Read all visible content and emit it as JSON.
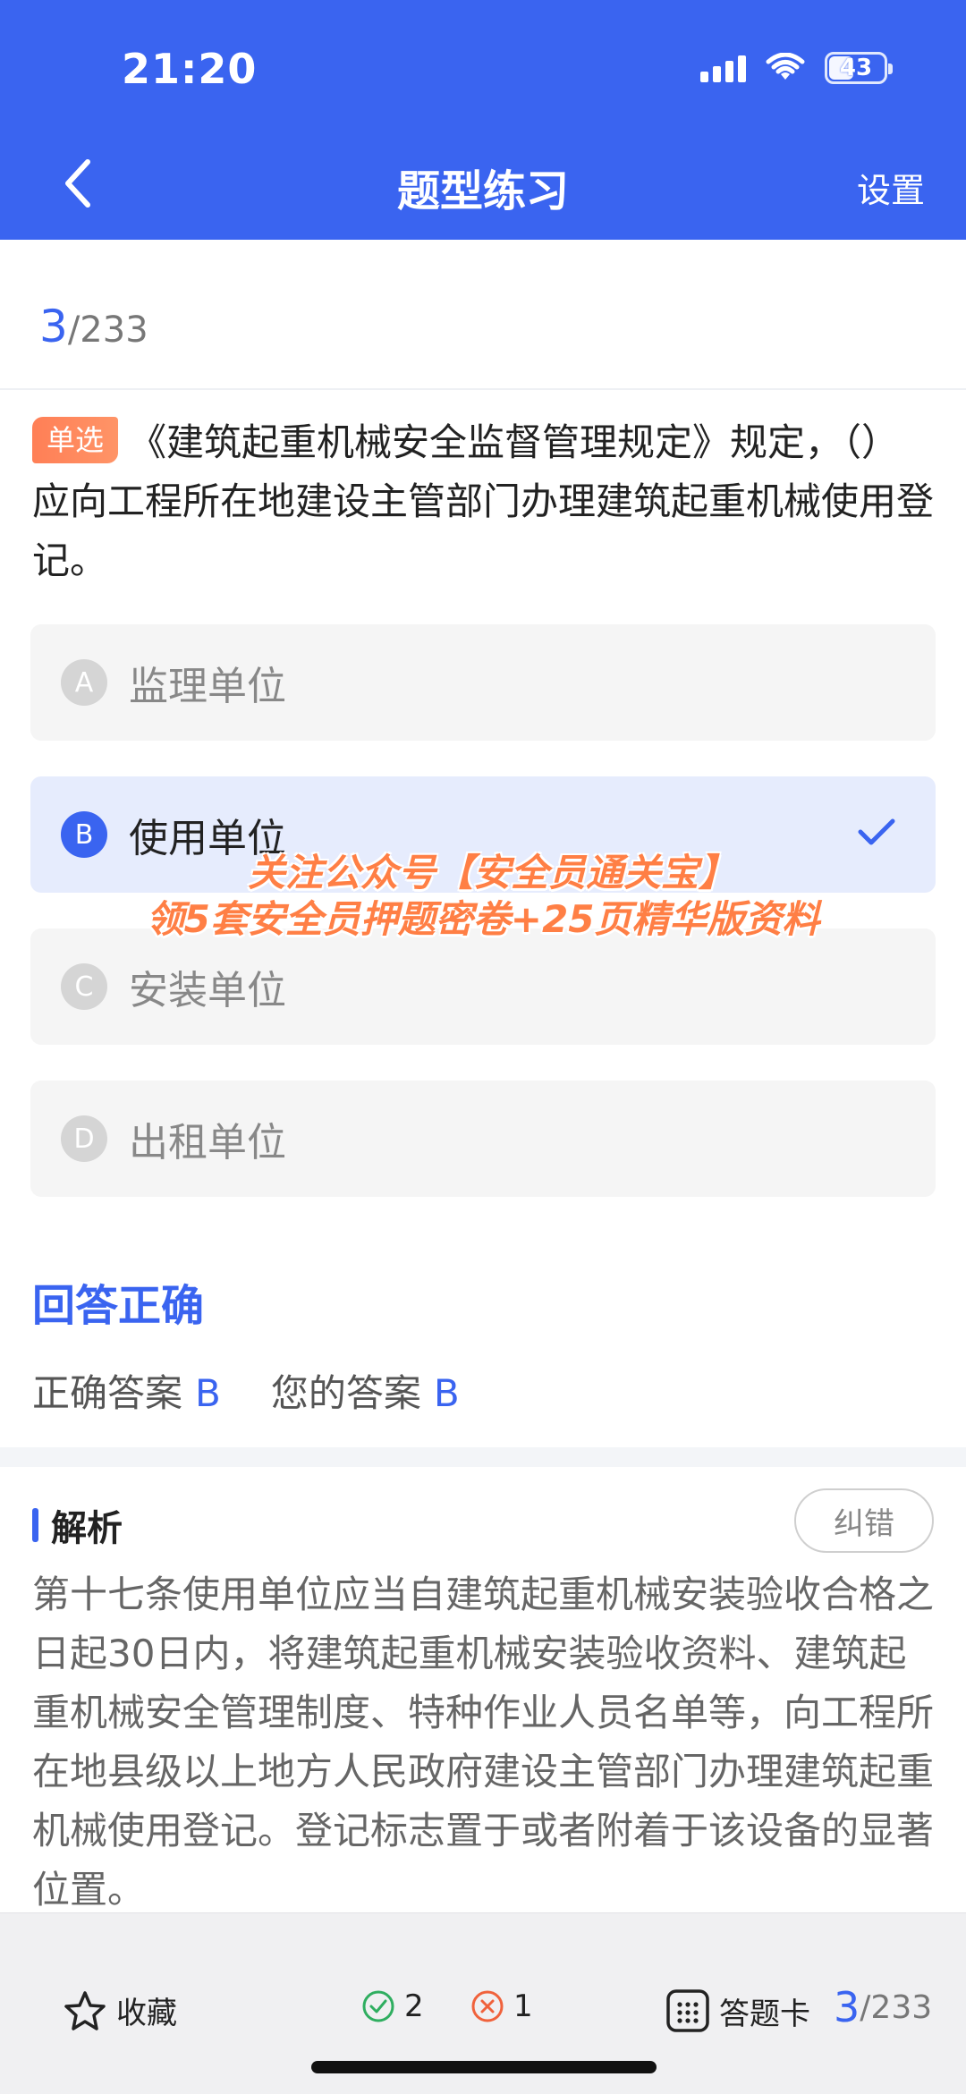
{
  "status_bar": {
    "time": "21:20",
    "battery": "43"
  },
  "header": {
    "title": "题型练习",
    "settings_label": "设置"
  },
  "progress": {
    "current": "3",
    "total": "/233"
  },
  "question": {
    "type_tag": "单选",
    "text": "《建筑起重机械安全监督管理规定》规定，（）应向工程所在地建设主管部门办理建筑起重机械使用登记。"
  },
  "options": [
    {
      "letter": "A",
      "text": "监理单位",
      "selected": false
    },
    {
      "letter": "B",
      "text": "使用单位",
      "selected": true
    },
    {
      "letter": "C",
      "text": "安装单位",
      "selected": false
    },
    {
      "letter": "D",
      "text": "出租单位",
      "selected": false
    }
  ],
  "watermark": {
    "line1": "关注公众号【安全员通关宝】",
    "line2": "领5套安全员押题密卷+25页精华版资料"
  },
  "result": {
    "title": "回答正确",
    "correct_label": "正确答案",
    "correct_value": "B",
    "your_label": "您的答案",
    "your_value": "B"
  },
  "analysis": {
    "title": "解析",
    "report_label": "纠错",
    "text": "第十七条使用单位应当自建筑起重机械安装验收合格之日起30日内，将建筑起重机械安装验收资料、建筑起重机械安全管理制度、特种作业人员名单等，向工程所在地县级以上地方人民政府建设主管部门办理建筑起重机械使用登记。登记标志置于或者附着于该设备的显著位置。"
  },
  "bottom_bar": {
    "favorite_label": "收藏",
    "correct_count": "2",
    "wrong_count": "1",
    "answer_card_label": "答题卡",
    "progress_current": "3",
    "progress_total": "/233"
  },
  "colors": {
    "accent": "#3a64f0",
    "tag": "#ff8a5c",
    "correct": "#2fae60",
    "wrong": "#f0623c"
  }
}
